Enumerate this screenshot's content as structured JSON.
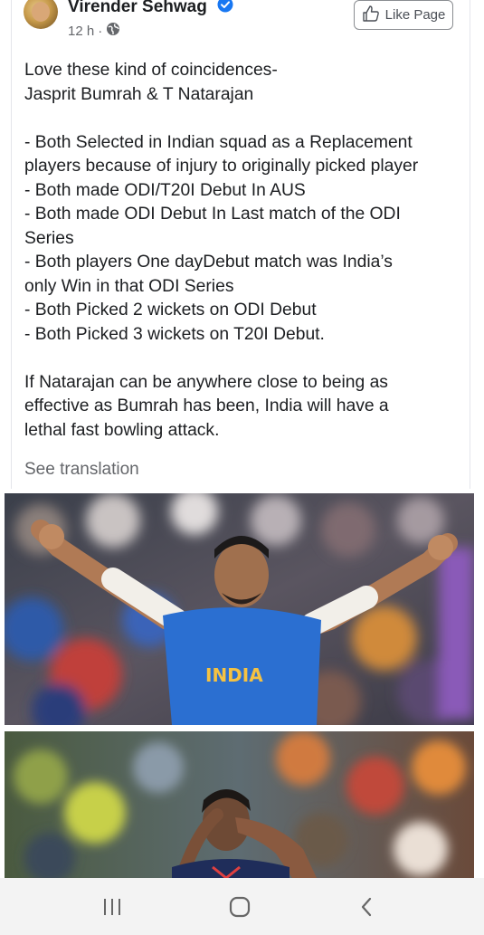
{
  "post": {
    "author": "Virender Sehwag",
    "time": "12 h",
    "separator": "·",
    "like_page_label": "Like Page",
    "lines": [
      "Love these kind of coincidences-",
      "Jasprit Bumrah & T Natarajan",
      "",
      "- Both Selected in Indian squad as a Replacement",
      "players because of injury to originally picked player",
      "- Both made ODI/T20I Debut In AUS",
      "- Both made ODI Debut In Last match of the ODI",
      "Series",
      "- Both players One dayDebut match was India’s",
      "only Win in that ODI Series",
      "- Both Picked 2 wickets on ODI Debut",
      "- Both Picked 3 wickets on T20I Debut.",
      "",
      " If Natarajan can be anywhere close to being as",
      "effective as Bumrah has been, India will have a",
      "lethal fast bowling attack."
    ],
    "see_translation": "See translation",
    "photo1_jersey_text": "INDIA"
  },
  "icons": {
    "verified": "verified-badge-icon",
    "globe": "globe-icon",
    "like": "thumbs-up-icon",
    "nav_recent": "recent-apps-icon",
    "nav_home": "home-icon",
    "nav_back": "back-icon"
  },
  "colors": {
    "verified_blue": "#1877f2",
    "secondary_text": "#65676b",
    "jersey_blue": "#2b6fd1",
    "navbar_bg": "#f3f3f3"
  }
}
